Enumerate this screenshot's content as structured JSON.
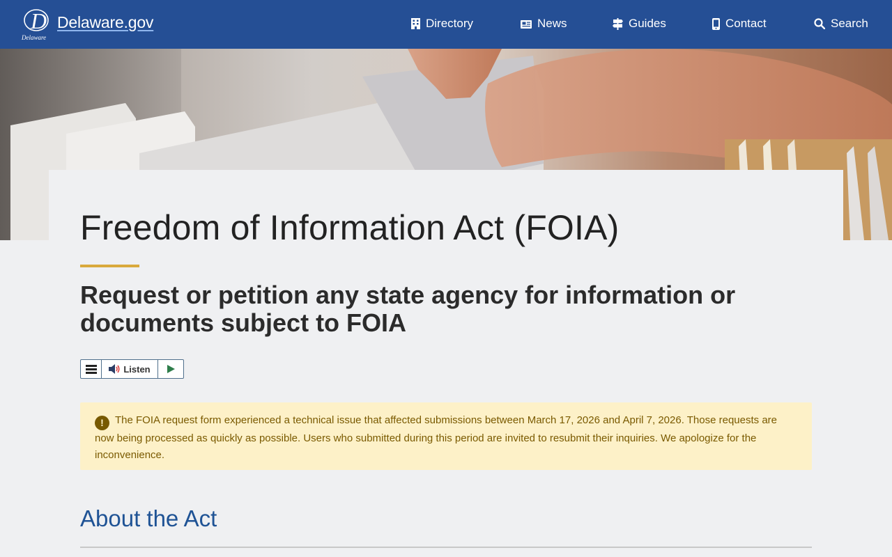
{
  "header": {
    "logo_text": "Delaware",
    "site_name": "Delaware.gov",
    "nav": [
      {
        "label": "Directory",
        "icon": "building-icon"
      },
      {
        "label": "News",
        "icon": "newspaper-icon"
      },
      {
        "label": "Guides",
        "icon": "signpost-icon"
      },
      {
        "label": "Contact",
        "icon": "phone-icon"
      },
      {
        "label": "Search",
        "icon": "search-icon"
      }
    ]
  },
  "hero": {
    "image": "hands-searching-file-folders"
  },
  "page": {
    "title": "Freedom of Information Act (FOIA)",
    "subtitle": "Request or petition any state agency for information or documents subject to FOIA",
    "accent_color": "#d9a93c"
  },
  "listen": {
    "label": "Listen"
  },
  "alert": {
    "icon": "exclamation-icon",
    "text": "The FOIA request form experienced a technical issue that affected submissions between March 17, 2026 and April 7, 2026. Those requests are now being processed as quickly as possible. Users who submitted during this period are invited to resubmit their inquiries. We apologize for the inconvenience."
  },
  "sections": [
    {
      "title": "About the Act"
    }
  ],
  "colors": {
    "header_bg": "#254f95",
    "alert_bg": "#fdf1c8",
    "link": "#1f5395"
  }
}
